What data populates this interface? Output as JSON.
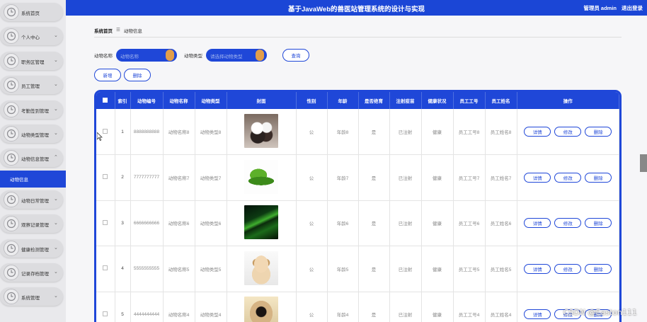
{
  "header": {
    "title": "基于JavaWeb的兽医站管理系统的设计与实现",
    "user_role": "管理员 admin",
    "logout": "退出登录"
  },
  "sidebar": {
    "items": [
      {
        "label": "系统首页",
        "arrow": ""
      },
      {
        "label": "个人中心",
        "arrow": "⌄"
      },
      {
        "label": "职务区管理",
        "arrow": "⌄"
      },
      {
        "label": "员工管理",
        "arrow": "⌄"
      },
      {
        "label": "考勤签到管理",
        "arrow": "⌄"
      },
      {
        "label": "动物类型管理",
        "arrow": "⌄"
      },
      {
        "label": "动物信息管理",
        "arrow": "⌃"
      }
    ],
    "active_sub": "动物信息",
    "items_after": [
      {
        "label": "动物日常管理",
        "arrow": "⌄"
      },
      {
        "label": "观察记录管理",
        "arrow": "⌄"
      },
      {
        "label": "健康检测管理",
        "arrow": "⌄"
      },
      {
        "label": "记录存档管理",
        "arrow": "⌄"
      },
      {
        "label": "系统管理",
        "arrow": "⌄"
      }
    ]
  },
  "breadcrumb": {
    "home": "系统首页",
    "sep": "☰",
    "current": "动物信息"
  },
  "search": {
    "name_label": "动物名称",
    "name_placeholder": "动物名称",
    "type_label": "动物类型",
    "type_placeholder": "请选择动物类型",
    "query_button": "查询"
  },
  "actions": {
    "new": "新增",
    "delete": "删除"
  },
  "table": {
    "headers": [
      "索引",
      "动物编号",
      "动物名称",
      "动物类型",
      "封面",
      "性别",
      "年龄",
      "是否绝育",
      "注射疫苗",
      "健康状况",
      "员工工号",
      "员工姓名",
      "操作"
    ],
    "rows": [
      {
        "index": "1",
        "code": "8888888888",
        "name": "动物名称8",
        "type": "动物类型8",
        "cover": "birds",
        "gender": "公",
        "age": "年龄8",
        "neutered": "是",
        "vaccine": "已注射",
        "health": "健康",
        "emp_no": "员工工号8",
        "emp_name": "员工姓名8"
      },
      {
        "index": "2",
        "code": "7777777777",
        "name": "动物名称7",
        "type": "动物类型7",
        "cover": "snake",
        "gender": "公",
        "age": "年龄7",
        "neutered": "是",
        "vaccine": "已注射",
        "health": "健康",
        "emp_no": "员工工号7",
        "emp_name": "员工姓名7"
      },
      {
        "index": "3",
        "code": "6666666666",
        "name": "动物名称6",
        "type": "动物类型6",
        "cover": "green-snake",
        "gender": "公",
        "age": "年龄6",
        "neutered": "是",
        "vaccine": "已注射",
        "health": "健康",
        "emp_no": "员工工号6",
        "emp_name": "员工姓名6"
      },
      {
        "index": "4",
        "code": "5555555555",
        "name": "动物名称5",
        "type": "动物类型5",
        "cover": "puppy",
        "gender": "公",
        "age": "年龄5",
        "neutered": "是",
        "vaccine": "已注射",
        "health": "健康",
        "emp_no": "员工工号5",
        "emp_name": "员工姓名5"
      },
      {
        "index": "5",
        "code": "4444444444",
        "name": "动物名称4",
        "type": "动物类型4",
        "cover": "pug",
        "gender": "公",
        "age": "年龄4",
        "neutered": "是",
        "vaccine": "已注射",
        "health": "健康",
        "emp_no": "员工工号4",
        "emp_name": "员工姓名4"
      }
    ],
    "op_labels": {
      "detail": "详情",
      "edit": "修改",
      "delete": "删除"
    }
  },
  "watermark": "CSDN @Easton111",
  "colors": {
    "primary": "#1f47d8",
    "accent_knob": "#e29e4a"
  }
}
